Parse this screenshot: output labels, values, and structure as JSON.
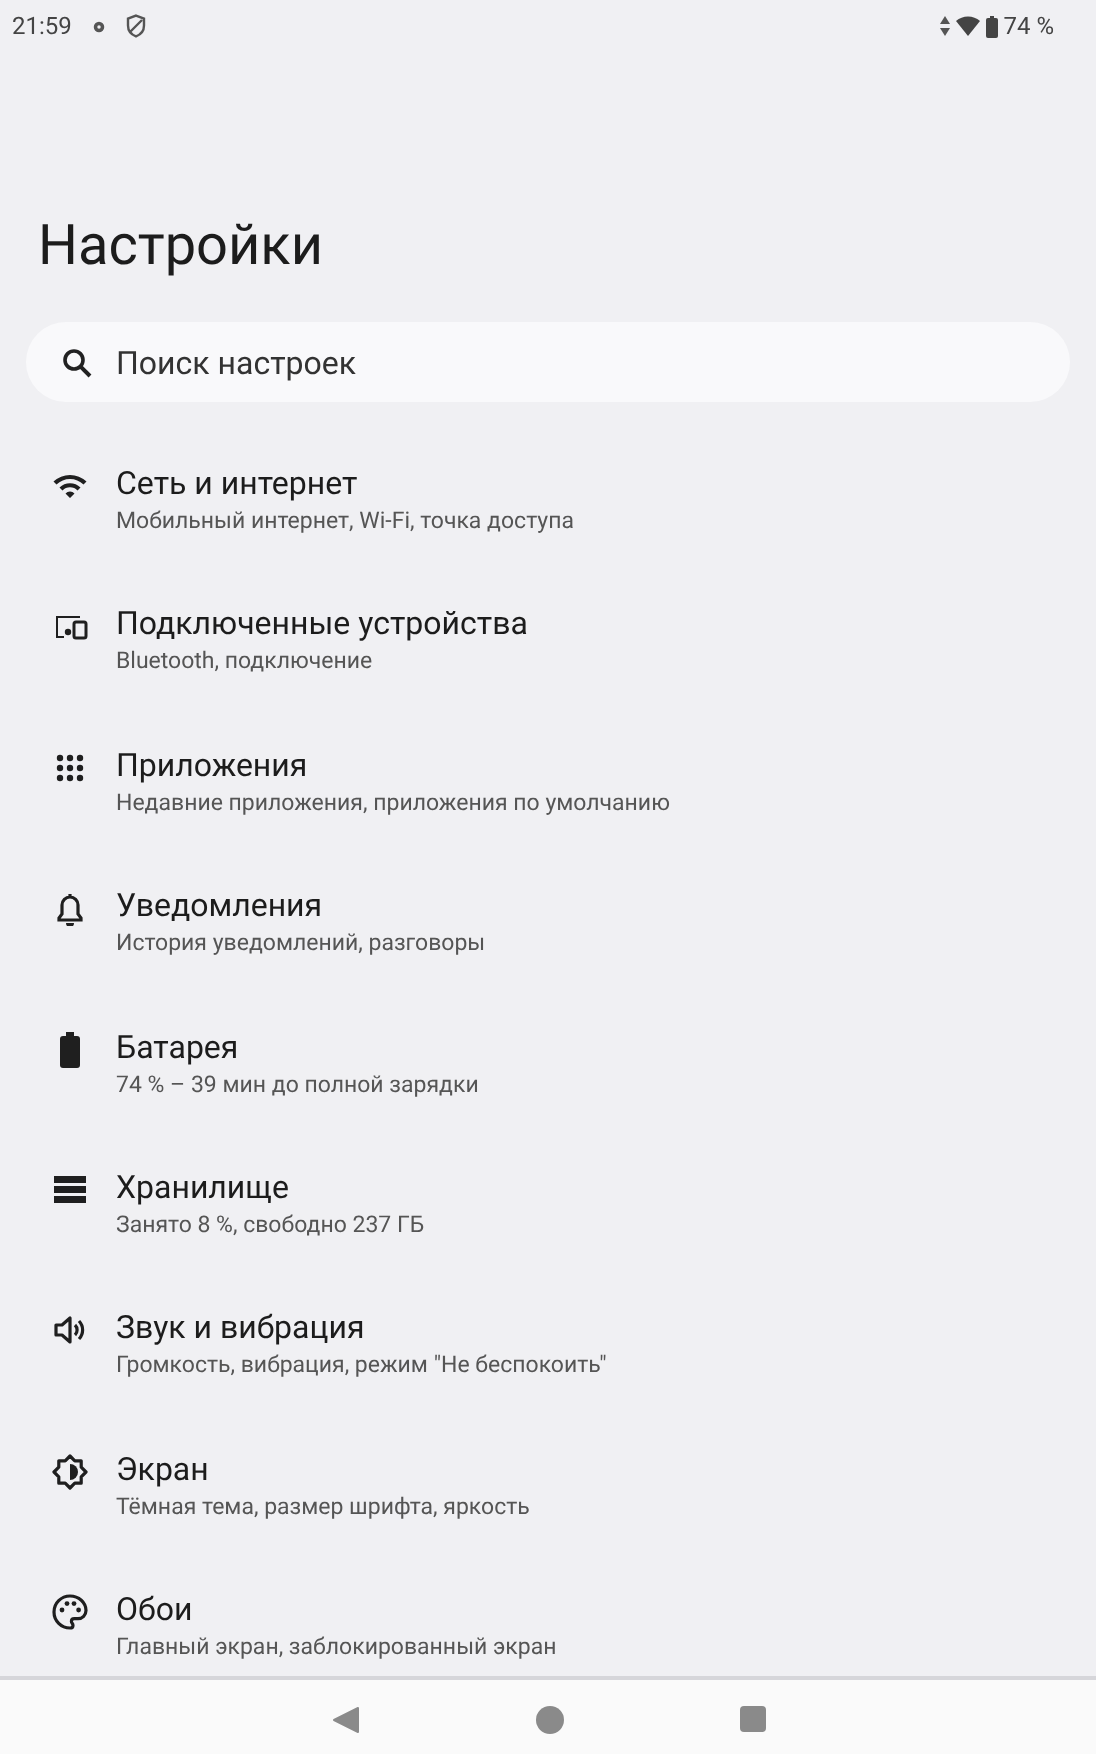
{
  "status_bar": {
    "time": "21:59",
    "battery": "74 %"
  },
  "title": "Настройки",
  "search": {
    "placeholder": "Поиск настроек"
  },
  "items": [
    {
      "title": "Сеть и интернет",
      "subtitle": "Мобильный интернет, Wi-Fi, точка доступа"
    },
    {
      "title": "Подключенные устройства",
      "subtitle": "Bluetooth, подключение"
    },
    {
      "title": "Приложения",
      "subtitle": "Недавние приложения, приложения по умолчанию"
    },
    {
      "title": "Уведомления",
      "subtitle": "История уведомлений, разговоры"
    },
    {
      "title": "Батарея",
      "subtitle": "74 % – 39 мин до полной зарядки"
    },
    {
      "title": "Хранилище",
      "subtitle": "Занято 8 %, свободно 237 ГБ"
    },
    {
      "title": "Звук и вибрация",
      "subtitle": "Громкость, вибрация, режим \"Не беспокоить\""
    },
    {
      "title": "Экран",
      "subtitle": "Тёмная тема, размер шрифта, яркость"
    },
    {
      "title": "Обои",
      "subtitle": "Главный экран, заблокированный экран"
    }
  ]
}
